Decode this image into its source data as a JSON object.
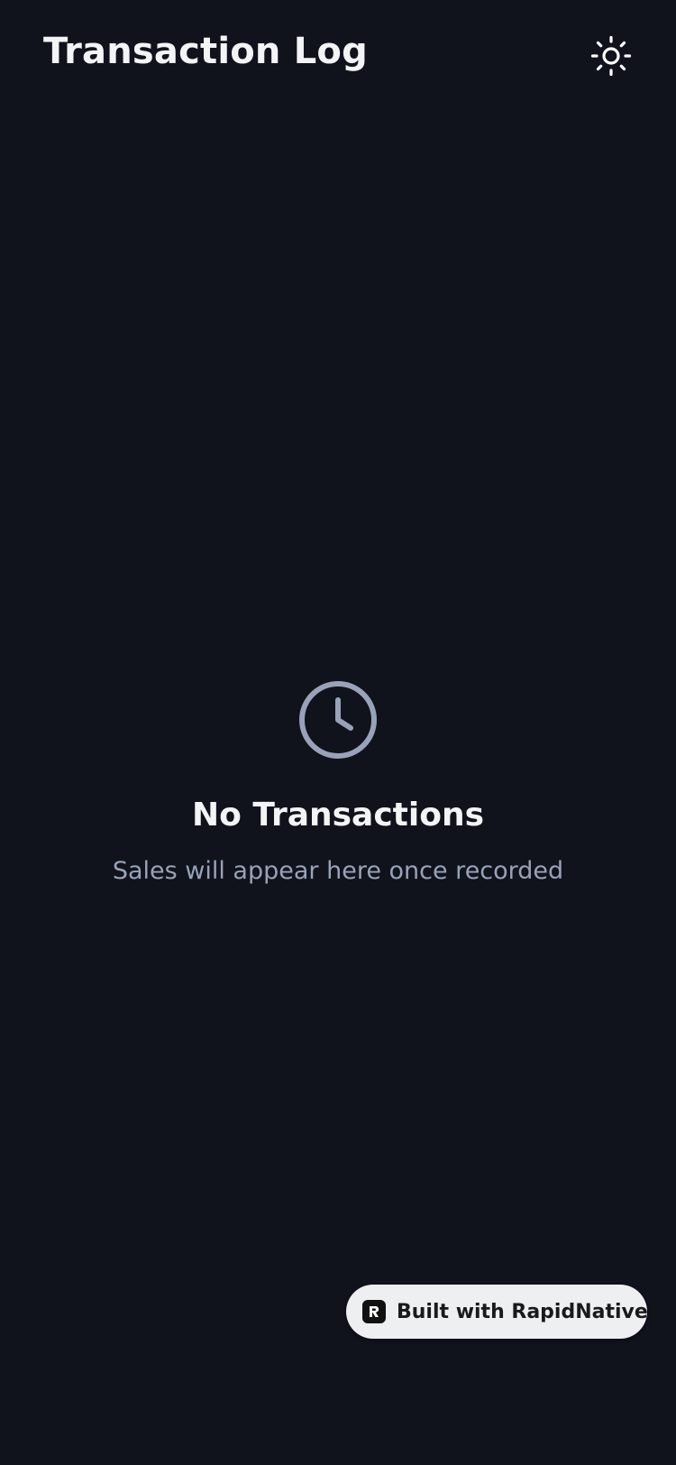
{
  "header": {
    "title": "Transaction Log",
    "theme_icon": "sun-icon"
  },
  "empty_state": {
    "icon": "clock-icon",
    "title": "No Transactions",
    "subtitle": "Sales will appear here once recorded"
  },
  "badge": {
    "label": "Built with RapidNative",
    "icon": "rapidnative-logo-icon"
  },
  "colors": {
    "background": "#10131c",
    "text_primary": "#f3f4f6",
    "text_secondary": "#98a2b8",
    "icon_muted": "#98a2b8",
    "badge_bg": "#eeeff1"
  }
}
